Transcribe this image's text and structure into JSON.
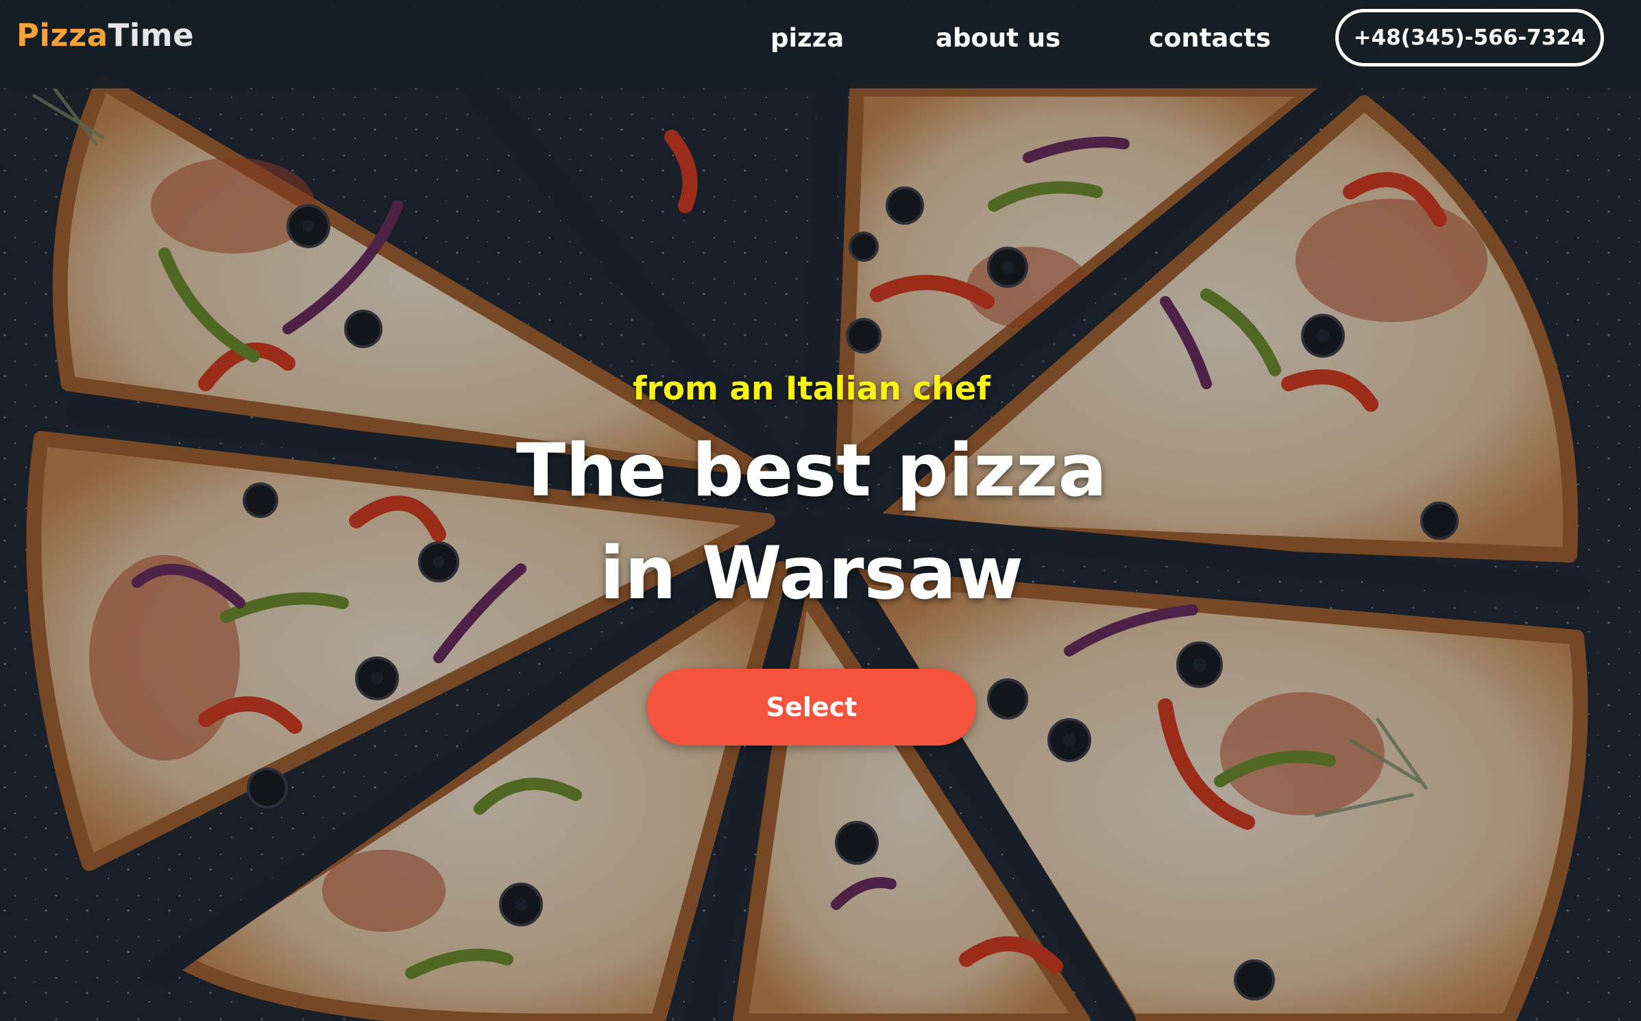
{
  "header": {
    "logo_part1": "Pizza",
    "logo_part2": "Time",
    "nav": [
      "pizza",
      "about us",
      "contacts"
    ],
    "phone": "+48(345)-566-7324"
  },
  "hero": {
    "subtitle": "from an Italian chef",
    "title_line1": "The best pizza",
    "title_line2": "in Warsaw",
    "cta_label": "Select",
    "background_image": "pizza-slices-photo"
  },
  "colors": {
    "logo_accent": "#f6a23a",
    "subtitle": "#f7f214",
    "cta": "#f5533d",
    "header_bg": "#161d25"
  }
}
